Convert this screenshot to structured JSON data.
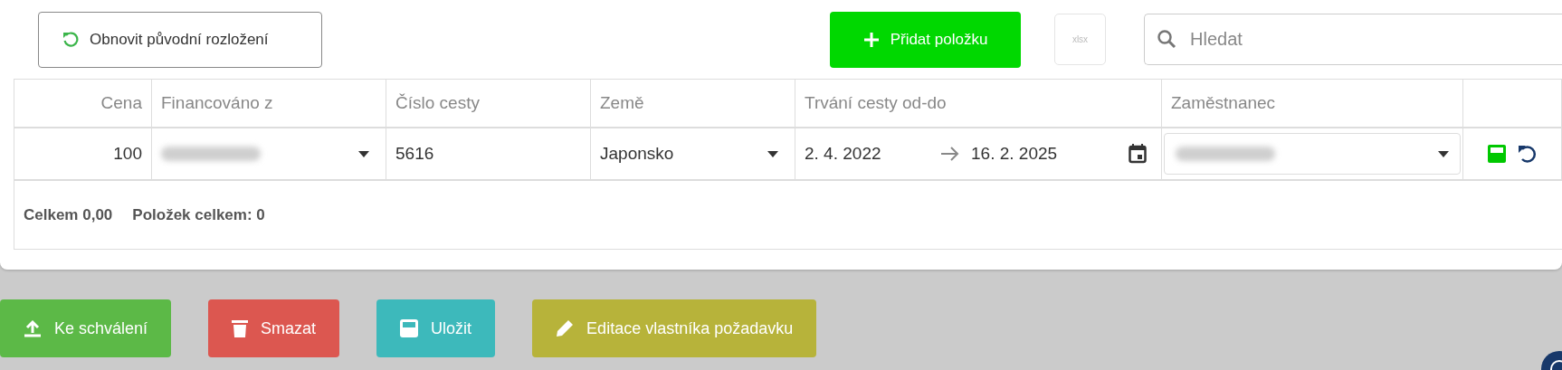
{
  "toolbar": {
    "restore_button": "Obnovit původní rozložení",
    "add_button": "Přidat položku",
    "export_button": {
      "label": "xlsx",
      "disabled": true
    },
    "search": {
      "placeholder": "Hledat"
    }
  },
  "table": {
    "columns": [
      "Cena",
      "Financováno z",
      "Číslo cesty",
      "Země",
      "Trvání cesty od-do",
      "Zaměstnanec"
    ],
    "rows": [
      {
        "cena": "100",
        "financovano_z": {
          "redacted": true
        },
        "cislo_cesty": "5616",
        "zeme": "Japonsko",
        "date_from": "2. 4. 2022",
        "date_to": "16. 2. 2025",
        "zamestnanec": {
          "redacted": true
        }
      }
    ],
    "footer": {
      "total": "Celkem 0,00",
      "count": "Položek celkem: 0"
    }
  },
  "actions": [
    {
      "kind": "submit",
      "label": "Ke schválení",
      "color": "#5cb947"
    },
    {
      "kind": "delete",
      "label": "Smazat",
      "color": "#dc5750"
    },
    {
      "kind": "save",
      "label": "Uložit",
      "color": "#3db9bb"
    },
    {
      "kind": "edit",
      "label": "Editace vlastníka požadavku",
      "color": "#b7b33a"
    }
  ]
}
